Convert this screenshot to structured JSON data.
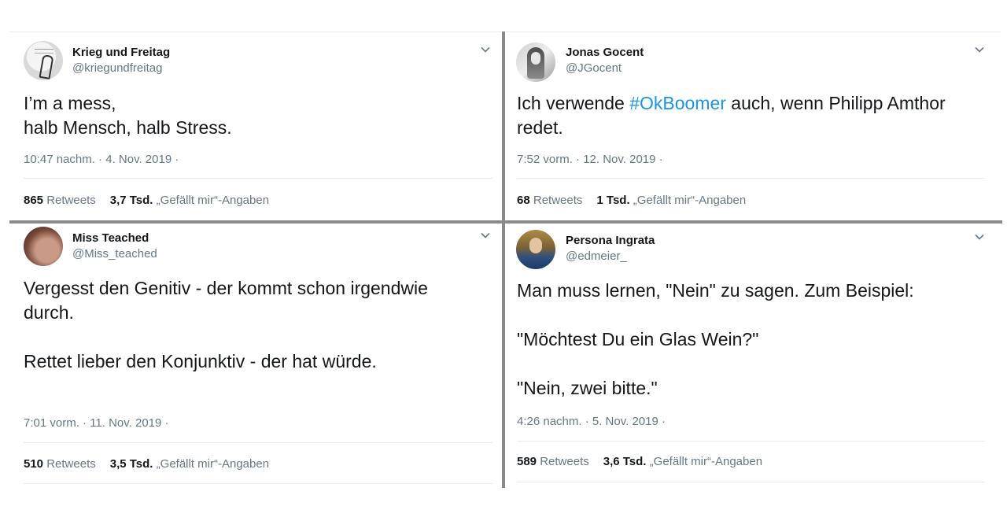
{
  "tweets": [
    {
      "name": "Krieg und Freitag",
      "handle": "@kriegundfreitag",
      "text": "I’m a mess,\nhalb Mensch, halb Stress.",
      "timestamp": "10:47 nachm. · 4. Nov. 2019 ·",
      "retweets": "865",
      "retweets_label": "Retweets",
      "likes": "3,7 Tsd.",
      "likes_label": "„Gefällt mir“-Angaben"
    },
    {
      "name": "Jonas Gocent",
      "handle": "@JGocent",
      "text_before": "Ich verwende ",
      "hashtag": "#OkBoomer",
      "text_after": " auch, wenn Philipp Amthor redet.",
      "timestamp": "7:52 vorm. · 12. Nov. 2019 ·",
      "retweets": "68",
      "retweets_label": "Retweets",
      "likes": "1 Tsd.",
      "likes_label": "„Gefällt mir“-Angaben"
    },
    {
      "name": "Miss Teached",
      "handle": "@Miss_teached",
      "text": "Vergesst den Genitiv - der kommt schon irgendwie durch.\n\nRettet lieber den Konjunktiv - der hat würde.",
      "timestamp": "7:01 vorm. · 11. Nov. 2019 ·",
      "retweets": "510",
      "retweets_label": "Retweets",
      "likes": "3,5 Tsd.",
      "likes_label": "„Gefällt mir“-Angaben"
    },
    {
      "name": "Persona Ingrata",
      "handle": "@edmeier_",
      "text": "Man muss lernen, \"Nein\" zu sagen. Zum Beispiel:\n\n\"Möchtest Du ein Glas Wein?\"\n\n\"Nein, zwei bitte.\"",
      "timestamp": "4:26 nachm. · 5. Nov. 2019 ·",
      "retweets": "589",
      "retweets_label": "Retweets",
      "likes": "3,6 Tsd.",
      "likes_label": "„Gefällt mir“-Angaben"
    }
  ],
  "icons": {
    "menu": "chevron-down-icon"
  },
  "colors": {
    "text": "#14171a",
    "muted": "#657786",
    "link": "#1b95e0",
    "separator": "#8a8a8a"
  }
}
